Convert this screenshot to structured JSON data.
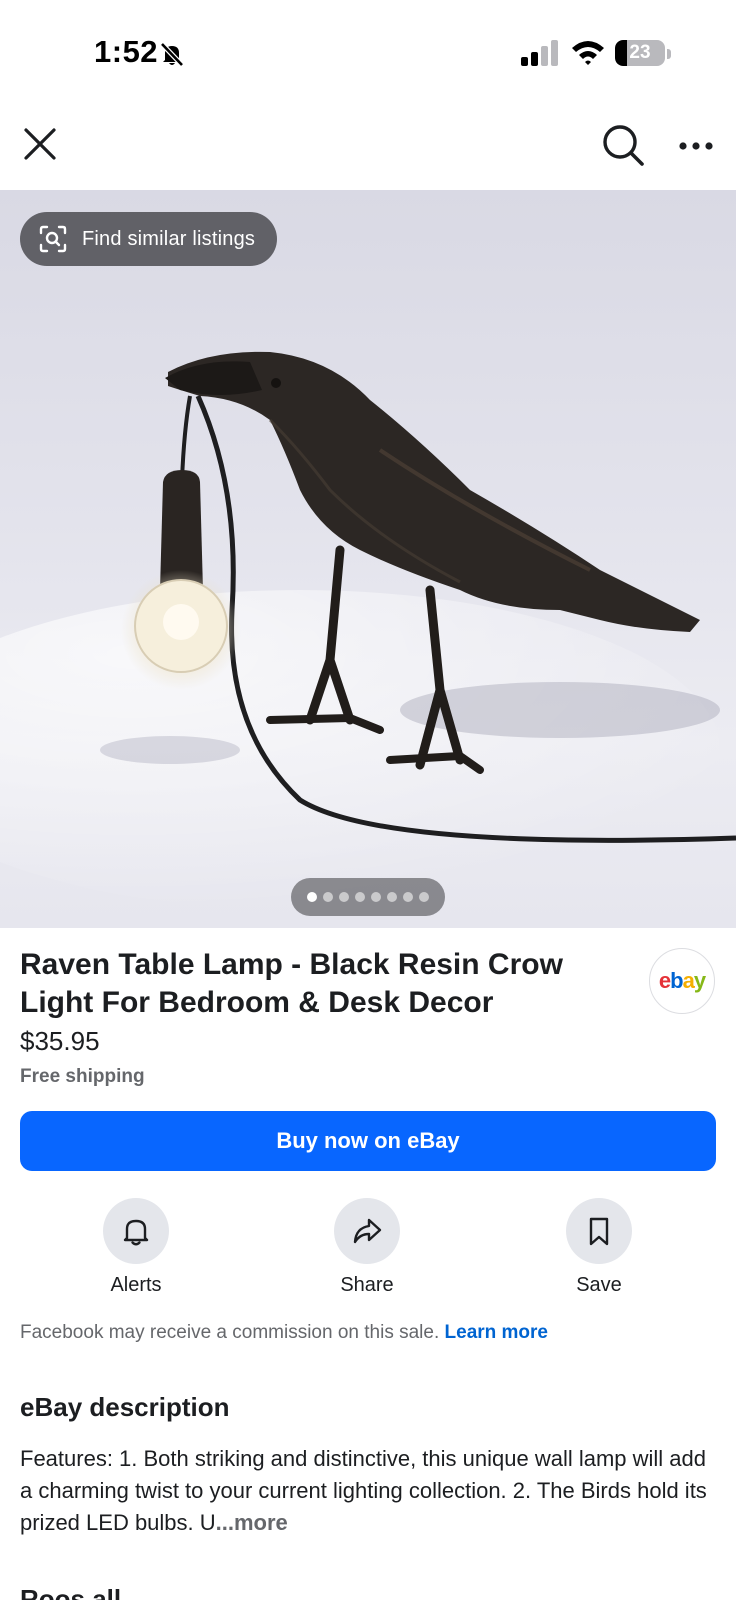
{
  "status_bar": {
    "time": "1:52",
    "battery_level": "23",
    "battery_fraction": 0.23,
    "signal_bars": 2,
    "signal_bars_total": 4,
    "icons": [
      "bell-slash-icon",
      "cellular-signal-icon",
      "wifi-icon",
      "battery-icon"
    ]
  },
  "nav": {
    "icons": [
      "close-icon",
      "search-icon",
      "more-options-icon"
    ]
  },
  "hero": {
    "find_similar_label": "Find similar listings",
    "find_similar_icon": "visual-search-icon",
    "image_count": 8,
    "active_image_index": 0
  },
  "listing": {
    "title": "Raven Table Lamp - Black Resin Crow Light For Bedroom & Desk Decor",
    "price": "$35.95",
    "shipping": "Free shipping",
    "seller_logo_letters": [
      "e",
      "b",
      "a",
      "y"
    ],
    "seller_logo_colors": [
      "#e53238",
      "#0064d2",
      "#f5af02",
      "#86b817"
    ],
    "buy_button_label": "Buy now on eBay",
    "accent_color": "#0866ff"
  },
  "actions": [
    {
      "label": "Alerts",
      "icon": "bell-icon"
    },
    {
      "label": "Share",
      "icon": "share-arrow-icon"
    },
    {
      "label": "Save",
      "icon": "bookmark-icon"
    }
  ],
  "commission": {
    "text": "Facebook may receive a commission on this sale. ",
    "link": "Learn more"
  },
  "description": {
    "heading": "eBay description",
    "text": "Features: 1. Both striking and distinctive, this unique wall lamp will add a charming twist to your current lighting collection. 2. The Birds hold its prized LED bulbs. U",
    "more_label": "...more"
  },
  "next_section_heading_partial": "Roos all"
}
